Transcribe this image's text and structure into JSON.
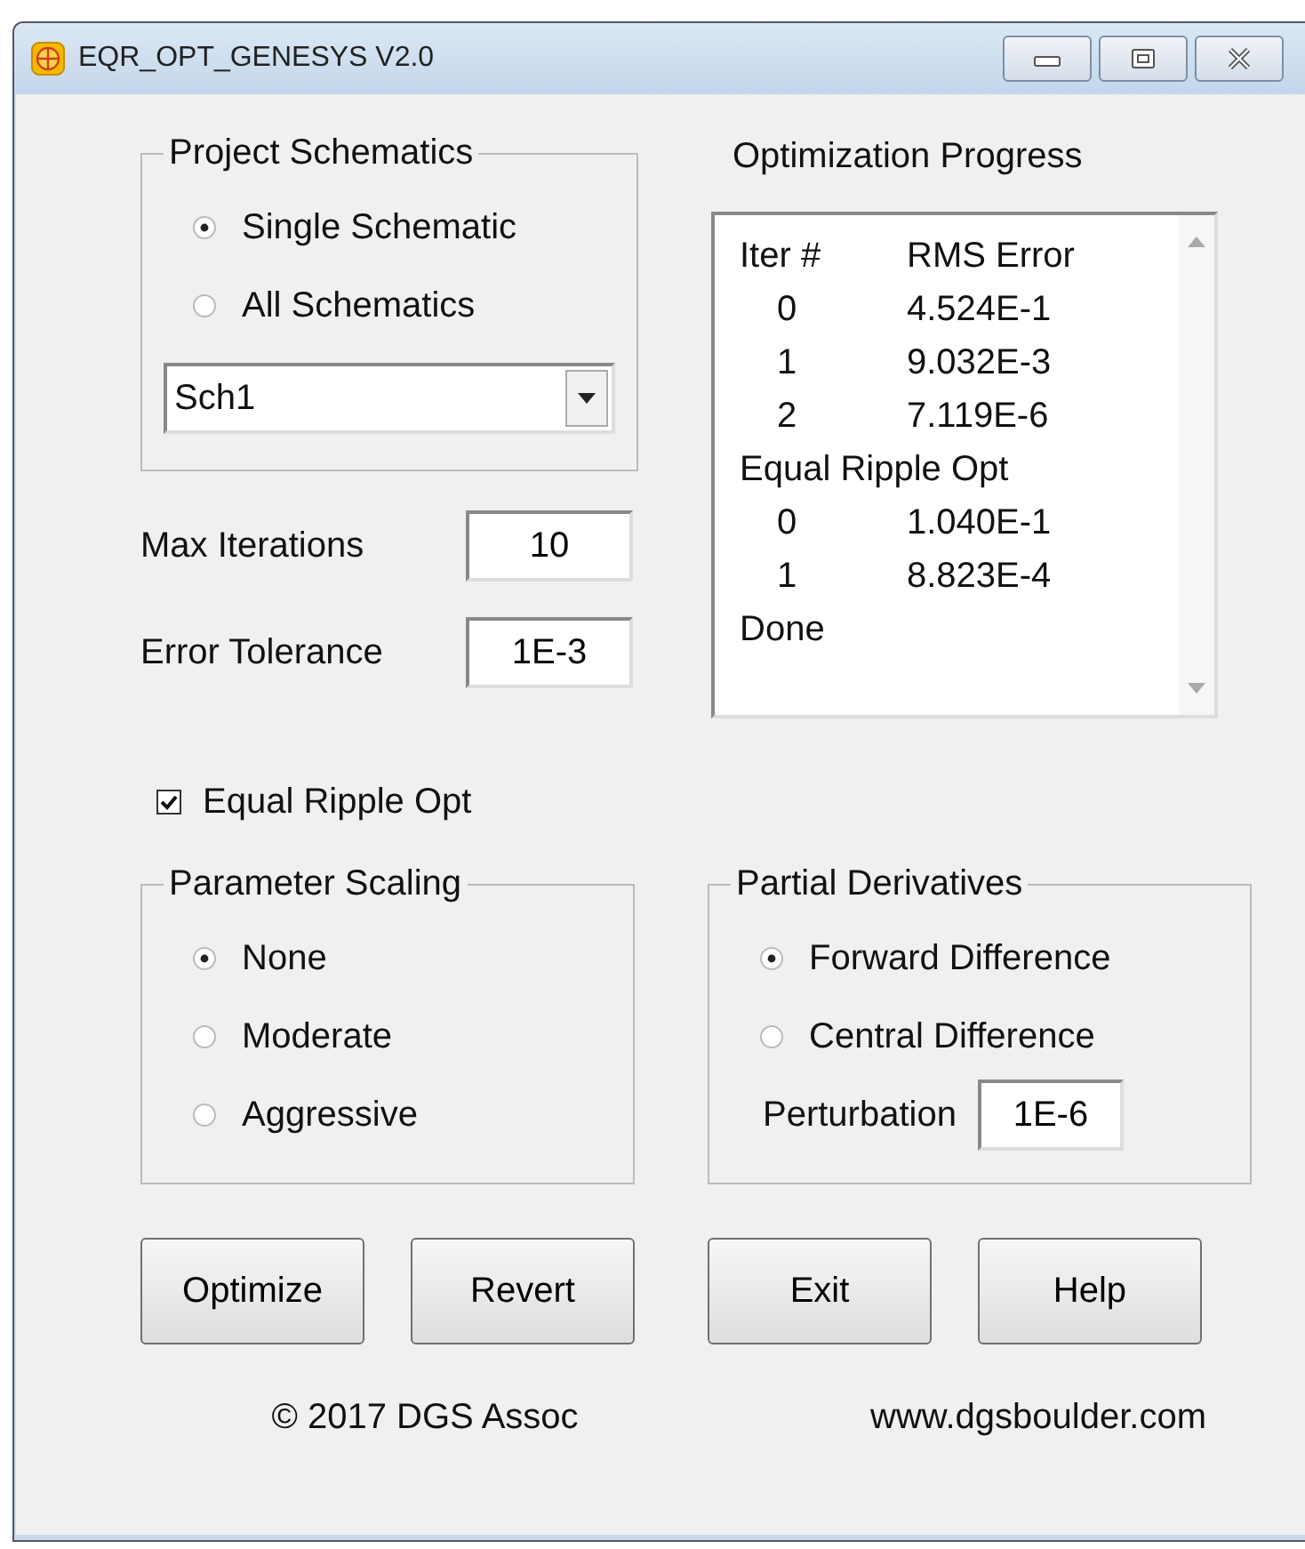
{
  "window": {
    "title": "EQR_OPT_GENESYS  V2.0"
  },
  "project_schematics": {
    "title": "Project Schematics",
    "options": [
      {
        "label": "Single Schematic",
        "selected": true
      },
      {
        "label": "All Schematics",
        "selected": false
      }
    ],
    "schematic_dropdown": {
      "value": "Sch1"
    }
  },
  "optimization_progress": {
    "title": "Optimization Progress",
    "lines": [
      {
        "kind": "header",
        "iter": "Iter #",
        "error": "RMS Error"
      },
      {
        "kind": "row",
        "iter": "0",
        "error": "4.524E-1"
      },
      {
        "kind": "row",
        "iter": "1",
        "error": "9.032E-3"
      },
      {
        "kind": "row",
        "iter": "2",
        "error": "7.119E-6"
      },
      {
        "kind": "note",
        "text": "Equal Ripple Opt"
      },
      {
        "kind": "row",
        "iter": "0",
        "error": "1.040E-1"
      },
      {
        "kind": "row",
        "iter": "1",
        "error": "8.823E-4"
      },
      {
        "kind": "note",
        "text": "Done"
      }
    ]
  },
  "max_iterations": {
    "label": "Max Iterations",
    "value": "10"
  },
  "error_tolerance": {
    "label": "Error Tolerance",
    "value": "1E-3"
  },
  "equal_ripple_opt": {
    "label": "Equal Ripple Opt",
    "checked": true
  },
  "parameter_scaling": {
    "title": "Parameter Scaling",
    "options": [
      {
        "label": "None",
        "selected": true
      },
      {
        "label": "Moderate",
        "selected": false
      },
      {
        "label": "Aggressive",
        "selected": false
      }
    ]
  },
  "partial_derivatives": {
    "title": "Partial Derivatives",
    "options": [
      {
        "label": "Forward Difference",
        "selected": true
      },
      {
        "label": "Central Difference",
        "selected": false
      }
    ],
    "perturbation": {
      "label": "Perturbation",
      "value": "1E-6"
    }
  },
  "buttons": [
    "Optimize",
    "Revert",
    "Exit",
    "Help"
  ],
  "footer": {
    "copyright": "© 2017 DGS Assoc",
    "website": "www.dgsboulder.com"
  }
}
